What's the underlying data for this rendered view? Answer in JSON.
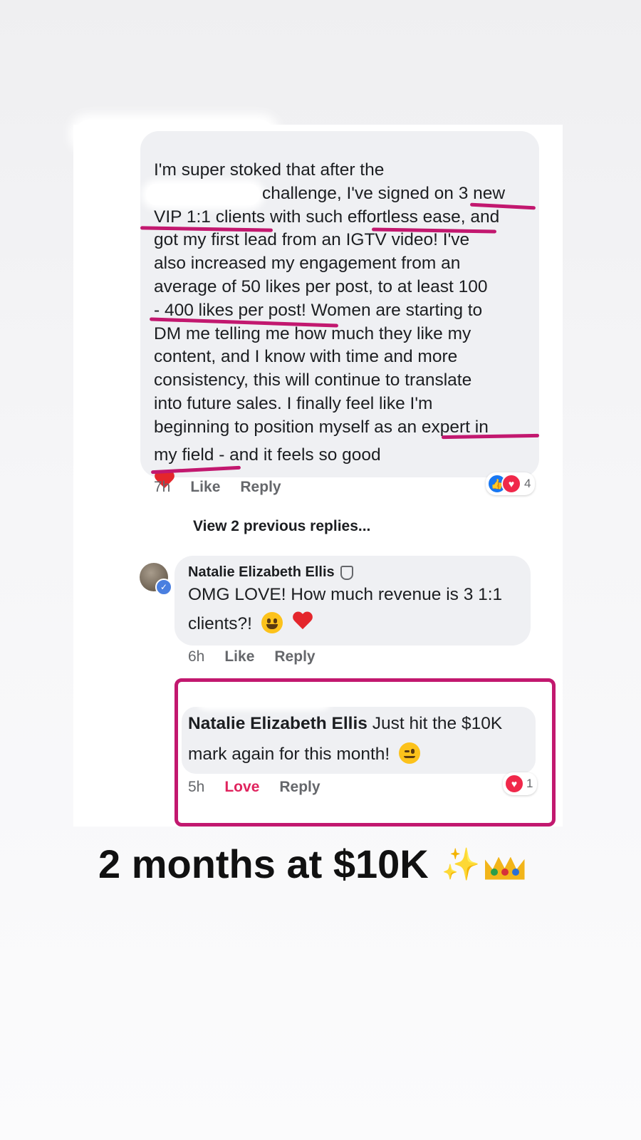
{
  "comment1": {
    "lines": [
      "I'm super stoked that after the",
      "challenge, I've signed on 3 new",
      "VIP 1:1 clients with such effortless ease, and",
      "got my first lead from an IGTV video! I've",
      "also increased my engagement from an",
      "average of 50 likes per post, to at least 100",
      "- 400 likes per post! Women are starting to",
      "DM me telling me how much they like my",
      "content, and I know with time and more",
      "consistency, this will continue to translate",
      "into future sales. I finally feel like I'm",
      "beginning to position myself as an expert in"
    ],
    "last_line": "my field - and it feels so good",
    "time": "7h",
    "like": "Like",
    "reply": "Reply",
    "reaction_count": "4",
    "reaction_icons": [
      "like-icon",
      "love-icon"
    ]
  },
  "view_replies": "View 2 previous replies...",
  "reply1": {
    "author": "Natalie Elizabeth Ellis",
    "text_line1": "OMG LOVE! How much revenue is 3 1:1",
    "text_line2": "clients?!",
    "time": "6h",
    "like": "Like",
    "reply": "Reply"
  },
  "reply2": {
    "author": "Natalie Elizabeth Ellis",
    "text_line1": "Just hit the $10K",
    "text_line2": "mark again for this month!",
    "time": "5h",
    "love": "Love",
    "reply": "Reply",
    "reaction_count": "1"
  },
  "caption": {
    "text": "2 months at $10K",
    "sparkle": "✨"
  },
  "colors": {
    "highlight": "#c2186f",
    "facebook_blue": "#1877f2",
    "love_red": "#e0245e"
  }
}
